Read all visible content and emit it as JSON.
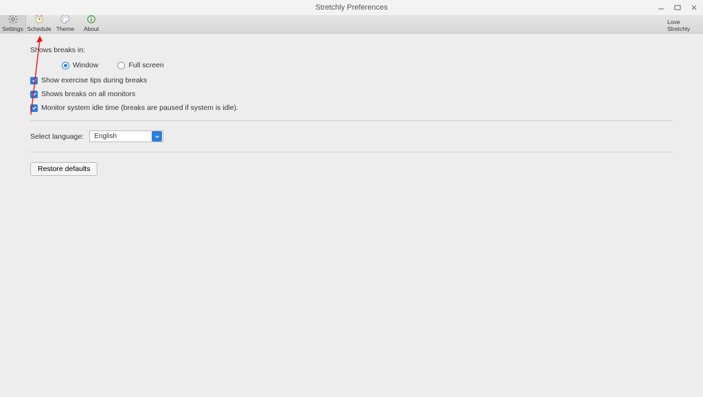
{
  "window": {
    "title": "Stretchly Preferences",
    "controls": {
      "minimize": "_",
      "maximize": "□",
      "close": "✕"
    }
  },
  "toolbar": {
    "items": [
      {
        "label": "Settings"
      },
      {
        "label": "Schedule"
      },
      {
        "label": "Theme"
      },
      {
        "label": "About"
      }
    ],
    "right": {
      "label": "Love Stretchly"
    }
  },
  "settings": {
    "shows_breaks_in_label": "Shows breaks in:",
    "radio_window": "Window",
    "radio_fullscreen": "Full screen",
    "cb_tips": "Show exercise tips during breaks",
    "cb_all_monitors": "Shows breaks on all monitors",
    "cb_idle": "Monitor system idle time (breaks are paused if system is idle).",
    "select_language_label": "Select language:",
    "select_language_value": "English",
    "restore_defaults": "Restore defaults"
  }
}
